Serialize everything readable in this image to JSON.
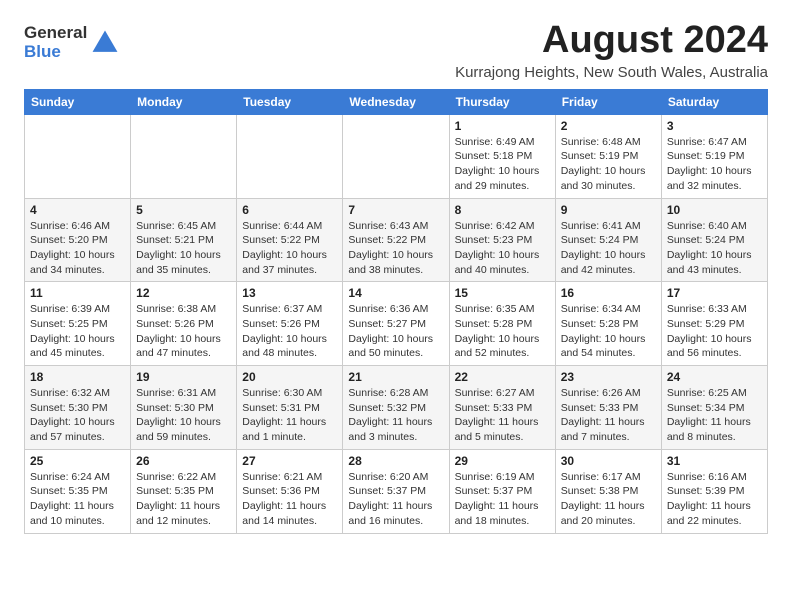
{
  "logo": {
    "general": "General",
    "blue": "Blue"
  },
  "title": {
    "month": "August 2024",
    "location": "Kurrajong Heights, New South Wales, Australia"
  },
  "weekdays": [
    "Sunday",
    "Monday",
    "Tuesday",
    "Wednesday",
    "Thursday",
    "Friday",
    "Saturday"
  ],
  "weeks": [
    [
      {
        "day": "",
        "info": ""
      },
      {
        "day": "",
        "info": ""
      },
      {
        "day": "",
        "info": ""
      },
      {
        "day": "",
        "info": ""
      },
      {
        "day": "1",
        "info": "Sunrise: 6:49 AM\nSunset: 5:18 PM\nDaylight: 10 hours\nand 29 minutes."
      },
      {
        "day": "2",
        "info": "Sunrise: 6:48 AM\nSunset: 5:19 PM\nDaylight: 10 hours\nand 30 minutes."
      },
      {
        "day": "3",
        "info": "Sunrise: 6:47 AM\nSunset: 5:19 PM\nDaylight: 10 hours\nand 32 minutes."
      }
    ],
    [
      {
        "day": "4",
        "info": "Sunrise: 6:46 AM\nSunset: 5:20 PM\nDaylight: 10 hours\nand 34 minutes."
      },
      {
        "day": "5",
        "info": "Sunrise: 6:45 AM\nSunset: 5:21 PM\nDaylight: 10 hours\nand 35 minutes."
      },
      {
        "day": "6",
        "info": "Sunrise: 6:44 AM\nSunset: 5:22 PM\nDaylight: 10 hours\nand 37 minutes."
      },
      {
        "day": "7",
        "info": "Sunrise: 6:43 AM\nSunset: 5:22 PM\nDaylight: 10 hours\nand 38 minutes."
      },
      {
        "day": "8",
        "info": "Sunrise: 6:42 AM\nSunset: 5:23 PM\nDaylight: 10 hours\nand 40 minutes."
      },
      {
        "day": "9",
        "info": "Sunrise: 6:41 AM\nSunset: 5:24 PM\nDaylight: 10 hours\nand 42 minutes."
      },
      {
        "day": "10",
        "info": "Sunrise: 6:40 AM\nSunset: 5:24 PM\nDaylight: 10 hours\nand 43 minutes."
      }
    ],
    [
      {
        "day": "11",
        "info": "Sunrise: 6:39 AM\nSunset: 5:25 PM\nDaylight: 10 hours\nand 45 minutes."
      },
      {
        "day": "12",
        "info": "Sunrise: 6:38 AM\nSunset: 5:26 PM\nDaylight: 10 hours\nand 47 minutes."
      },
      {
        "day": "13",
        "info": "Sunrise: 6:37 AM\nSunset: 5:26 PM\nDaylight: 10 hours\nand 48 minutes."
      },
      {
        "day": "14",
        "info": "Sunrise: 6:36 AM\nSunset: 5:27 PM\nDaylight: 10 hours\nand 50 minutes."
      },
      {
        "day": "15",
        "info": "Sunrise: 6:35 AM\nSunset: 5:28 PM\nDaylight: 10 hours\nand 52 minutes."
      },
      {
        "day": "16",
        "info": "Sunrise: 6:34 AM\nSunset: 5:28 PM\nDaylight: 10 hours\nand 54 minutes."
      },
      {
        "day": "17",
        "info": "Sunrise: 6:33 AM\nSunset: 5:29 PM\nDaylight: 10 hours\nand 56 minutes."
      }
    ],
    [
      {
        "day": "18",
        "info": "Sunrise: 6:32 AM\nSunset: 5:30 PM\nDaylight: 10 hours\nand 57 minutes."
      },
      {
        "day": "19",
        "info": "Sunrise: 6:31 AM\nSunset: 5:30 PM\nDaylight: 10 hours\nand 59 minutes."
      },
      {
        "day": "20",
        "info": "Sunrise: 6:30 AM\nSunset: 5:31 PM\nDaylight: 11 hours\nand 1 minute."
      },
      {
        "day": "21",
        "info": "Sunrise: 6:28 AM\nSunset: 5:32 PM\nDaylight: 11 hours\nand 3 minutes."
      },
      {
        "day": "22",
        "info": "Sunrise: 6:27 AM\nSunset: 5:33 PM\nDaylight: 11 hours\nand 5 minutes."
      },
      {
        "day": "23",
        "info": "Sunrise: 6:26 AM\nSunset: 5:33 PM\nDaylight: 11 hours\nand 7 minutes."
      },
      {
        "day": "24",
        "info": "Sunrise: 6:25 AM\nSunset: 5:34 PM\nDaylight: 11 hours\nand 8 minutes."
      }
    ],
    [
      {
        "day": "25",
        "info": "Sunrise: 6:24 AM\nSunset: 5:35 PM\nDaylight: 11 hours\nand 10 minutes."
      },
      {
        "day": "26",
        "info": "Sunrise: 6:22 AM\nSunset: 5:35 PM\nDaylight: 11 hours\nand 12 minutes."
      },
      {
        "day": "27",
        "info": "Sunrise: 6:21 AM\nSunset: 5:36 PM\nDaylight: 11 hours\nand 14 minutes."
      },
      {
        "day": "28",
        "info": "Sunrise: 6:20 AM\nSunset: 5:37 PM\nDaylight: 11 hours\nand 16 minutes."
      },
      {
        "day": "29",
        "info": "Sunrise: 6:19 AM\nSunset: 5:37 PM\nDaylight: 11 hours\nand 18 minutes."
      },
      {
        "day": "30",
        "info": "Sunrise: 6:17 AM\nSunset: 5:38 PM\nDaylight: 11 hours\nand 20 minutes."
      },
      {
        "day": "31",
        "info": "Sunrise: 6:16 AM\nSunset: 5:39 PM\nDaylight: 11 hours\nand 22 minutes."
      }
    ]
  ]
}
